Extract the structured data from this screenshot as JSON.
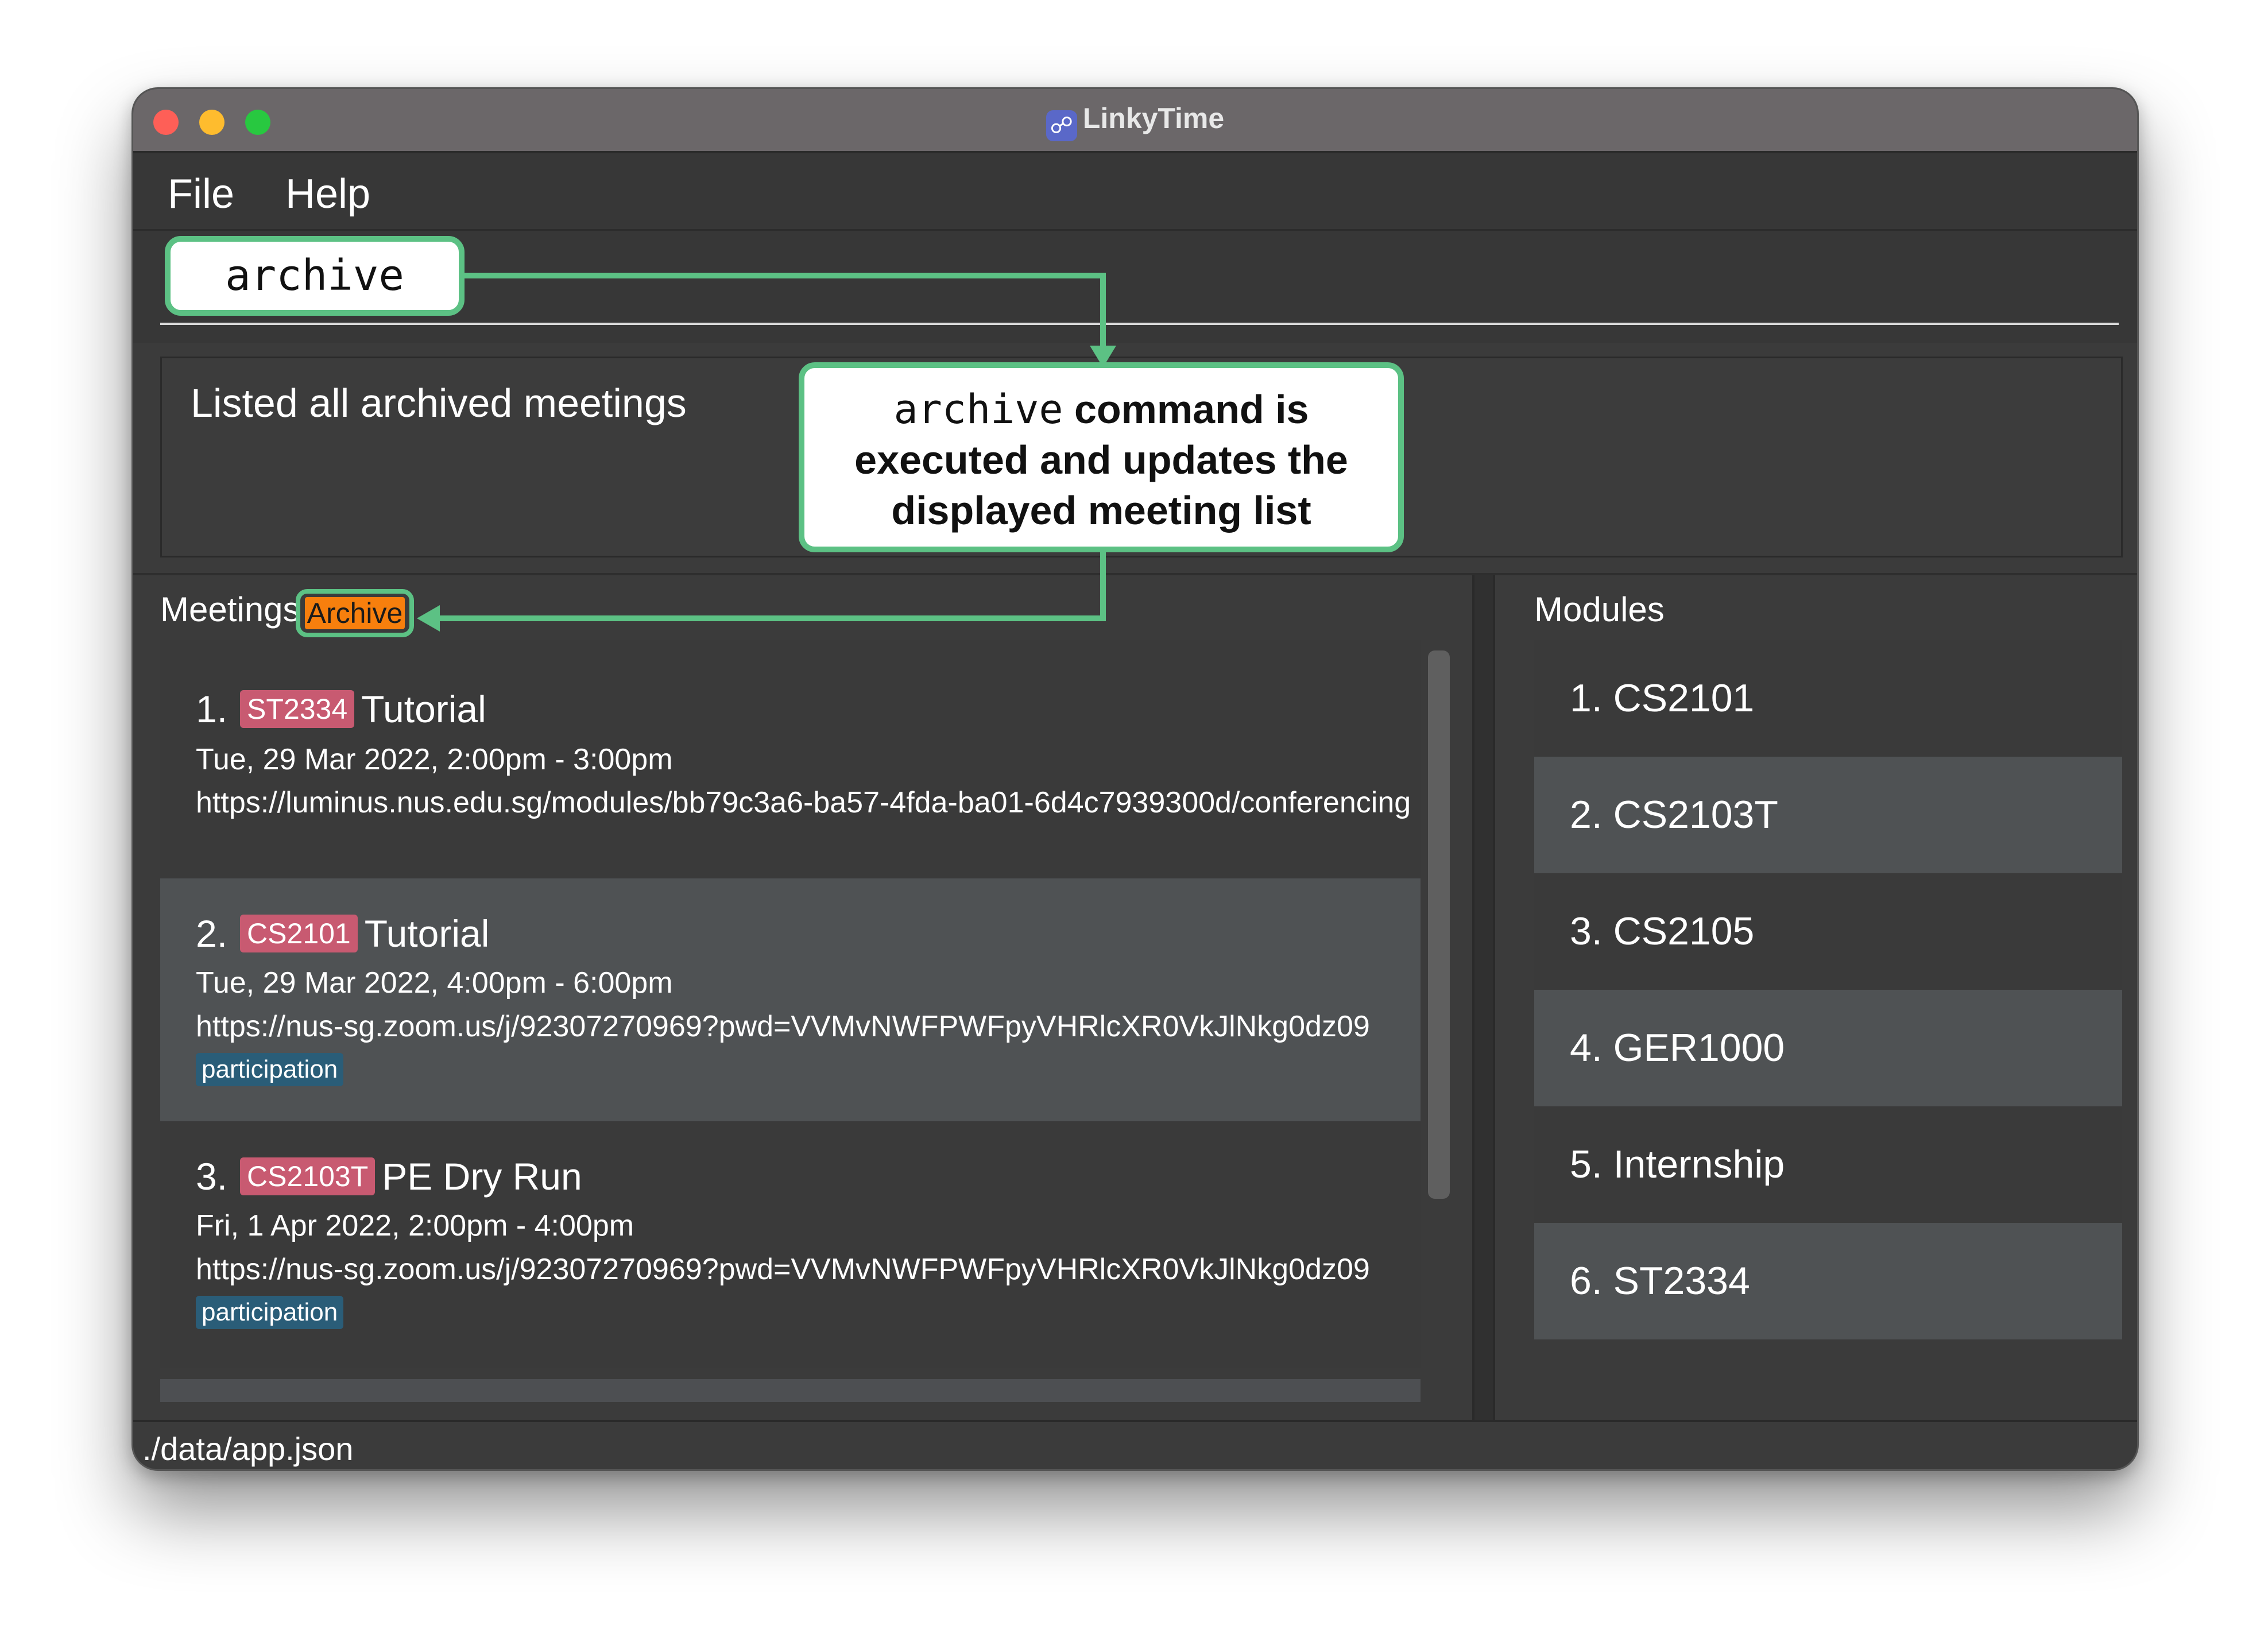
{
  "window": {
    "title": "LinkyTime",
    "app_icon": "link-icon"
  },
  "menu": {
    "file": "File",
    "help": "Help"
  },
  "command": {
    "text": "archive"
  },
  "callout": {
    "command_word": "archive",
    "line1_rest": " command is",
    "line2": "executed and updates the",
    "line3": "displayed meeting list"
  },
  "result": {
    "message": "Listed all archived meetings"
  },
  "meetings_panel": {
    "title": "Meetings",
    "badge": "Archive",
    "items": [
      {
        "index": "1.",
        "code": "ST2334",
        "name": "Tutorial",
        "datetime": "Tue, 29 Mar 2022, 2:00pm  -  3:00pm",
        "url": "https://luminus.nus.edu.sg/modules/bb79c3a6-ba57-4fda-ba01-6d4c7939300d/conferencing",
        "tag": ""
      },
      {
        "index": "2.",
        "code": "CS2101",
        "name": "Tutorial",
        "datetime": "Tue, 29 Mar 2022, 4:00pm  -  6:00pm",
        "url": "https://nus-sg.zoom.us/j/92307270969?pwd=VVMvNWFPWFpyVHRlcXR0VkJlNkg0dz09",
        "tag": "participation"
      },
      {
        "index": "3.",
        "code": "CS2103T",
        "name": "PE Dry Run",
        "datetime": "Fri, 1 Apr 2022, 2:00pm  -  4:00pm",
        "url": "https://nus-sg.zoom.us/j/92307270969?pwd=VVMvNWFPWFpyVHRlcXR0VkJlNkg0dz09",
        "tag": "participation"
      }
    ]
  },
  "modules_panel": {
    "title": "Modules",
    "items": [
      {
        "label": "1.  CS2101"
      },
      {
        "label": "2.  CS2103T"
      },
      {
        "label": "3.  CS2105"
      },
      {
        "label": "4.  GER1000"
      },
      {
        "label": "5.  Internship"
      },
      {
        "label": "6.  ST2334"
      }
    ]
  },
  "status": {
    "path": "./data/app.json"
  },
  "colors": {
    "callout_green": "#5cc184",
    "archive_orange": "#f77f0d",
    "module_tag_pink": "#c85a71",
    "participation_blue": "#2a5d78"
  }
}
